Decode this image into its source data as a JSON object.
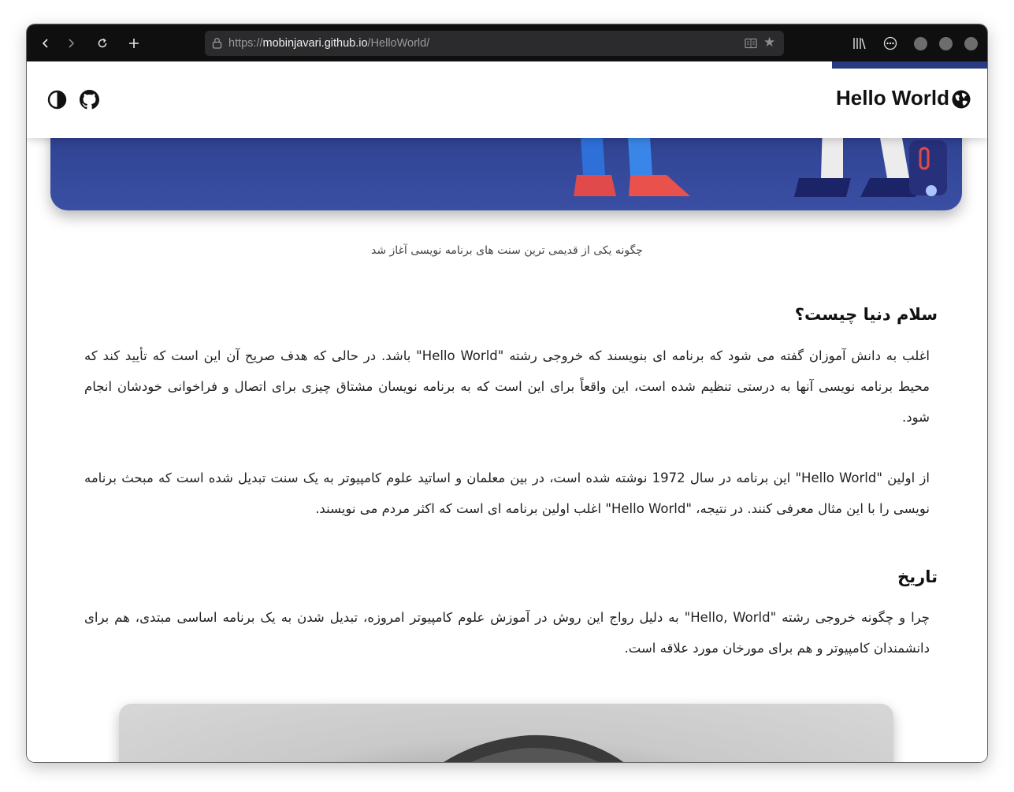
{
  "browser": {
    "url_scheme": "https://",
    "url_host": "mobinjavari.github.io",
    "url_path": "/HelloWorld/"
  },
  "header": {
    "site_title": "Hello World",
    "accent_color": "#2b3b82"
  },
  "hero": {
    "caption": "چگونه یکی از قدیمی ترین سنت های برنامه نویسی آغاز شد"
  },
  "sections": [
    {
      "heading": "سلام دنیا چیست؟",
      "paragraphs": [
        "اغلب به دانش آموزان گفته می شود که برنامه ای بنویسند که خروجی رشته \"Hello World\" باشد. در حالی که هدف صریح آن این است که تأیید کند که محیط برنامه نویسی آنها به درستی تنظیم شده است، این واقعاً برای این است که به برنامه نویسان مشتاق چیزی برای اتصال و فراخوانی خودشان انجام شود.",
        "از اولین \"Hello World\" این برنامه در سال 1972 نوشته شده است، در بین معلمان و اساتید علوم کامپیوتر به یک سنت تبدیل شده است که مبحث برنامه نویسی را با این مثال معرفی کنند. در نتیجه، \"Hello World\" اغلب اولین برنامه ای است که اکثر مردم می نویسند."
      ]
    },
    {
      "heading": "تاریخ",
      "paragraphs": [
        "چرا و چگونه خروجی رشته \"Hello, World\" به دلیل رواج این روش در آموزش علوم کامپیوتر امروزه، تبدیل شدن به یک برنامه اساسی مبتدی، هم برای دانشمندان کامپیوتر و هم برای مورخان مورد علاقه است."
      ]
    }
  ]
}
